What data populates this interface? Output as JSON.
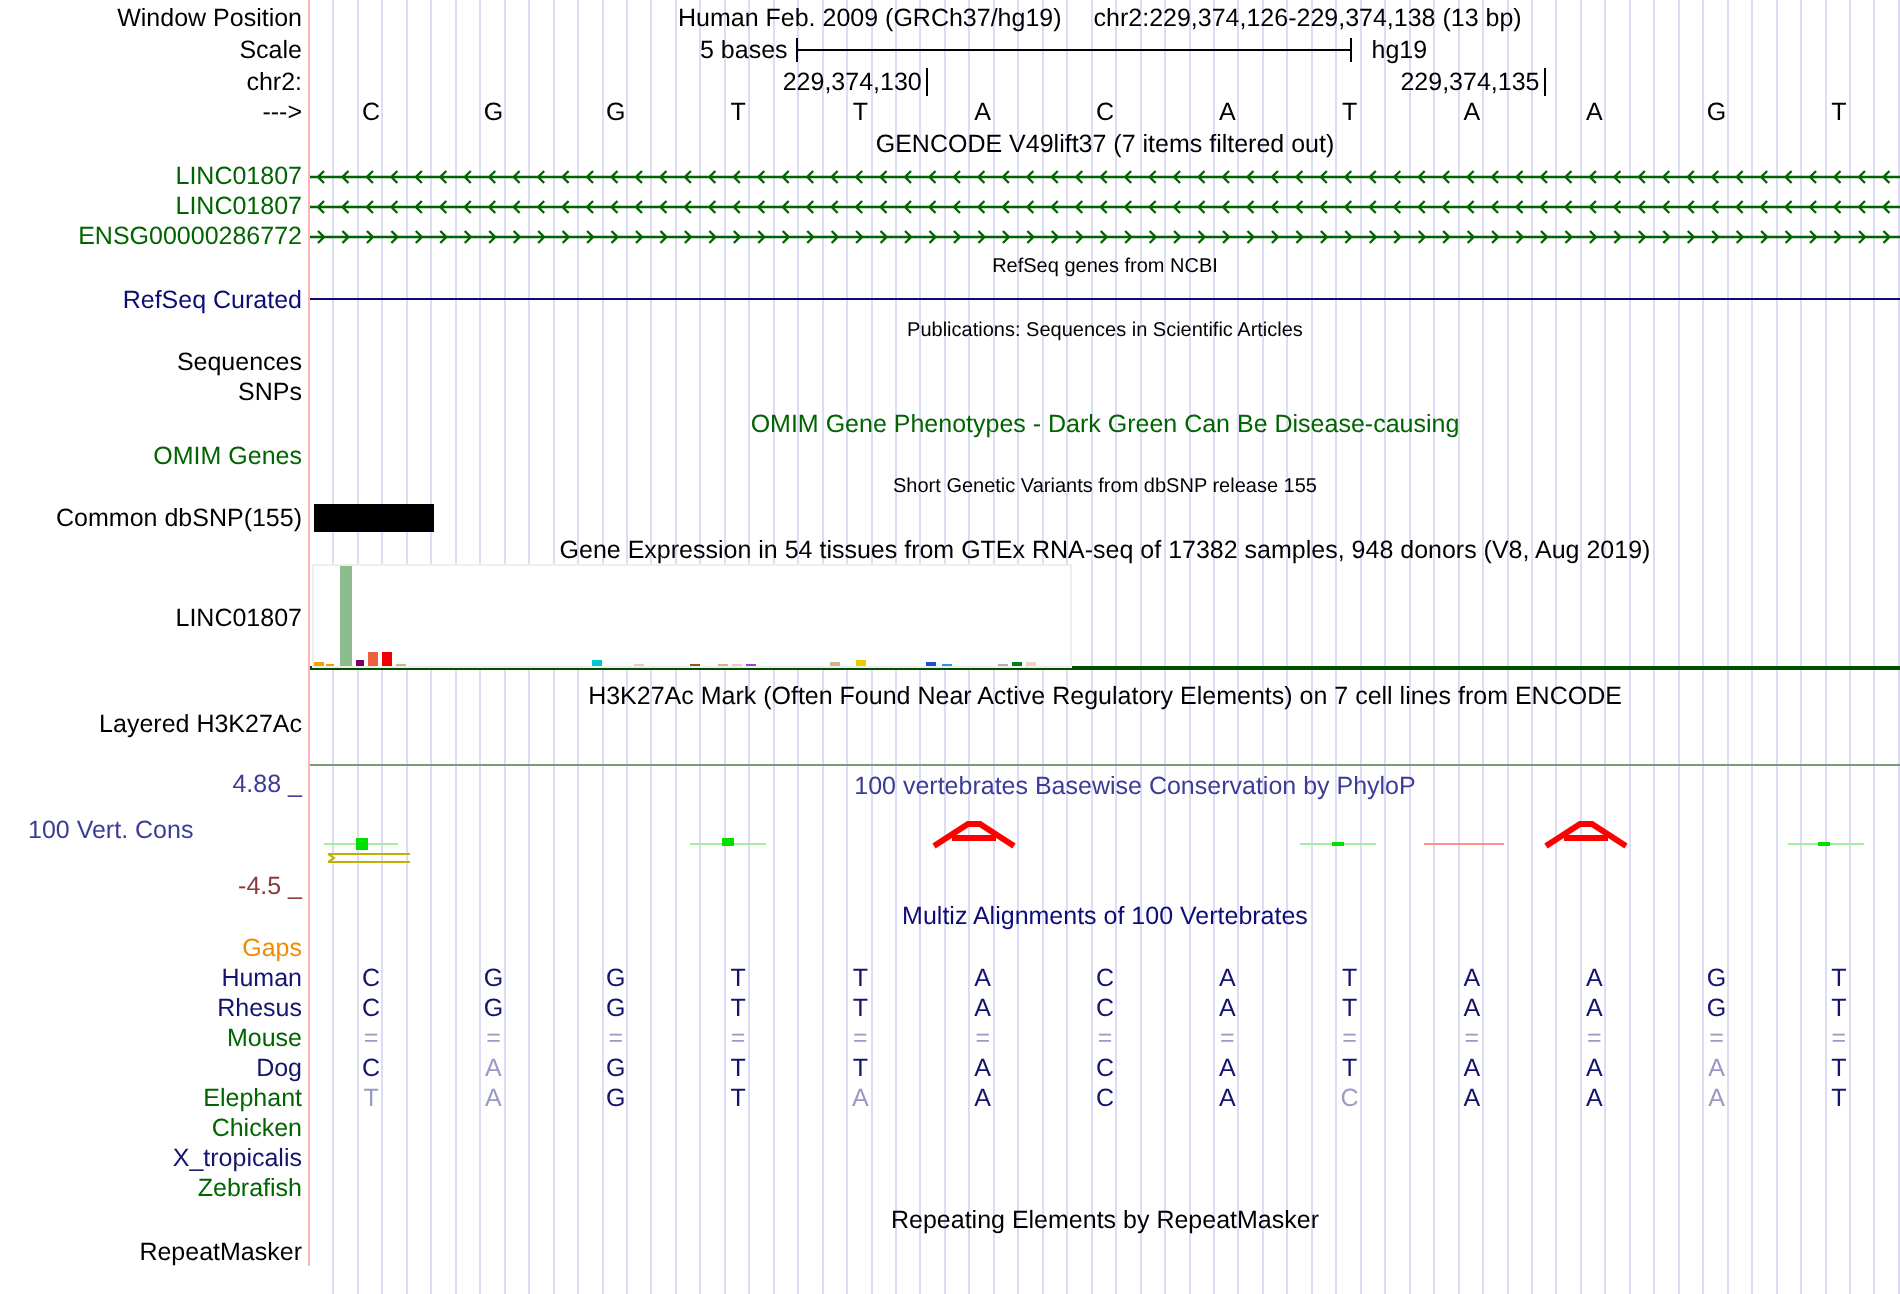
{
  "header": {
    "position_label": "Window Position",
    "assembly": "Human Feb. 2009 (GRCh37/hg19)",
    "position": "chr2:229,374,126-229,374,138 (13 bp)",
    "scale_label": "Scale",
    "scale_text": "5 bases",
    "scale_db": "hg19",
    "chrom_label": "chr2:",
    "strand_label": "--->",
    "bases": [
      {
        "base": "C"
      },
      {
        "base": "G"
      },
      {
        "base": "G"
      },
      {
        "base": "T"
      },
      {
        "base": "T",
        "tick": "229,374,130"
      },
      {
        "base": "A"
      },
      {
        "base": "C"
      },
      {
        "base": "A"
      },
      {
        "base": "T"
      },
      {
        "base": "A",
        "tick": "229,374,135"
      },
      {
        "base": "A"
      },
      {
        "base": "G"
      },
      {
        "base": "T"
      }
    ]
  },
  "tracks": [
    {
      "kind": "title",
      "text": "GENCODE V49lift37 (7 items filtered out)",
      "small": false
    },
    {
      "kind": "gene",
      "label": "LINC01807",
      "color": "#006400",
      "reverse": true
    },
    {
      "kind": "gene",
      "label": "LINC01807",
      "color": "#006400",
      "reverse": true
    },
    {
      "kind": "gene",
      "label": "ENSG00000286772",
      "color": "#006400",
      "reverse": false
    },
    {
      "kind": "title",
      "text": "RefSeq genes from NCBI",
      "small": true
    },
    {
      "kind": "line",
      "label": "RefSeq Curated",
      "color": "#0c0c78"
    },
    {
      "kind": "title",
      "text": "Publications: Sequences in Scientific Articles",
      "small": true
    },
    {
      "kind": "label",
      "label": "Sequences"
    },
    {
      "kind": "label",
      "label": "SNPs"
    },
    {
      "kind": "title",
      "text": "OMIM Gene Phenotypes - Dark Green Can Be Disease-causing",
      "small": false,
      "color": "#006400"
    },
    {
      "kind": "label",
      "label": "OMIM Genes",
      "color": "#006400"
    },
    {
      "kind": "title",
      "text": "Short Genetic Variants from dbSNP release 155",
      "small": true
    },
    {
      "kind": "snp",
      "label": "Common dbSNP(155)"
    },
    {
      "kind": "title",
      "text": "Gene Expression in 54 tissues from GTEx RNA-seq of 17382 samples, 948 donors (V8, Aug 2019)",
      "small": false
    },
    {
      "kind": "expression",
      "label": "LINC01807"
    },
    {
      "kind": "title",
      "text": "H3K27Ac Mark (Often Found Near Active Regulatory Elements) on 7 cell lines from ENCODE",
      "small": false,
      "tall": true
    },
    {
      "kind": "signal",
      "label": "Layered H3K27Ac"
    },
    {
      "kind": "conservation",
      "label": "100 Vert. Cons",
      "max_label": "4.88 _",
      "min_label": "-4.5 _",
      "title": "100 vertebrates Basewise Conservation by PhyloP"
    },
    {
      "kind": "title",
      "text": "Multiz Alignments of 100 Vertebrates",
      "small": false,
      "color": "#0c0c78"
    },
    {
      "kind": "label",
      "label": "Gaps",
      "color": "#f08c00"
    },
    {
      "kind": "alignment",
      "label": "Human",
      "color": "#14146e",
      "bases": [
        {
          "base": "C",
          "faded": false
        },
        {
          "base": "G",
          "faded": false
        },
        {
          "base": "G",
          "faded": false
        },
        {
          "base": "T",
          "faded": false
        },
        {
          "base": "T",
          "faded": false
        },
        {
          "base": "A",
          "faded": false
        },
        {
          "base": "C",
          "faded": false
        },
        {
          "base": "A",
          "faded": false
        },
        {
          "base": "T",
          "faded": false
        },
        {
          "base": "A",
          "faded": false
        },
        {
          "base": "A",
          "faded": false
        },
        {
          "base": "G",
          "faded": false
        },
        {
          "base": "T",
          "faded": false
        }
      ]
    },
    {
      "kind": "alignment",
      "label": "Rhesus",
      "color": "#14146e",
      "bases": [
        {
          "base": "C",
          "faded": false
        },
        {
          "base": "G",
          "faded": false
        },
        {
          "base": "G",
          "faded": false
        },
        {
          "base": "T",
          "faded": false
        },
        {
          "base": "T",
          "faded": false
        },
        {
          "base": "A",
          "faded": false
        },
        {
          "base": "C",
          "faded": false
        },
        {
          "base": "A",
          "faded": false
        },
        {
          "base": "T",
          "faded": false
        },
        {
          "base": "A",
          "faded": false
        },
        {
          "base": "A",
          "faded": false
        },
        {
          "base": "G",
          "faded": false
        },
        {
          "base": "T",
          "faded": false
        }
      ]
    },
    {
      "kind": "alignment",
      "label": "Mouse",
      "color": "#006400",
      "bases": [
        {
          "base": "=",
          "faded": true
        },
        {
          "base": "=",
          "faded": true
        },
        {
          "base": "=",
          "faded": true
        },
        {
          "base": "=",
          "faded": true
        },
        {
          "base": "=",
          "faded": true
        },
        {
          "base": "=",
          "faded": true
        },
        {
          "base": "=",
          "faded": true
        },
        {
          "base": "=",
          "faded": true
        },
        {
          "base": "=",
          "faded": true
        },
        {
          "base": "=",
          "faded": true
        },
        {
          "base": "=",
          "faded": true
        },
        {
          "base": "=",
          "faded": true
        },
        {
          "base": "=",
          "faded": true
        }
      ]
    },
    {
      "kind": "alignment",
      "label": "Dog",
      "color": "#14146e",
      "bases": [
        {
          "base": "C",
          "faded": false
        },
        {
          "base": "A",
          "faded": true
        },
        {
          "base": "G",
          "faded": false
        },
        {
          "base": "T",
          "faded": false
        },
        {
          "base": "T",
          "faded": false
        },
        {
          "base": "A",
          "faded": false
        },
        {
          "base": "C",
          "faded": false
        },
        {
          "base": "A",
          "faded": false
        },
        {
          "base": "T",
          "faded": false
        },
        {
          "base": "A",
          "faded": false
        },
        {
          "base": "A",
          "faded": false
        },
        {
          "base": "A",
          "faded": true
        },
        {
          "base": "T",
          "faded": false
        }
      ]
    },
    {
      "kind": "alignment",
      "label": "Elephant",
      "color": "#006400",
      "bases": [
        {
          "base": "T",
          "faded": true
        },
        {
          "base": "A",
          "faded": true
        },
        {
          "base": "G",
          "faded": false
        },
        {
          "base": "T",
          "faded": false
        },
        {
          "base": "A",
          "faded": true
        },
        {
          "base": "A",
          "faded": false
        },
        {
          "base": "C",
          "faded": false
        },
        {
          "base": "A",
          "faded": false
        },
        {
          "base": "C",
          "faded": true
        },
        {
          "base": "A",
          "faded": false
        },
        {
          "base": "A",
          "faded": false
        },
        {
          "base": "A",
          "faded": true
        },
        {
          "base": "T",
          "faded": false
        }
      ]
    },
    {
      "kind": "alignment",
      "label": "Chicken",
      "color": "#006400"
    },
    {
      "kind": "alignment",
      "label": "X_tropicalis",
      "color": "#14146e"
    },
    {
      "kind": "alignment",
      "label": "Zebrafish",
      "color": "#006400"
    },
    {
      "kind": "title",
      "text": "Repeating Elements by RepeatMasker",
      "small": false
    },
    {
      "kind": "label",
      "label": "RepeatMasker"
    }
  ]
}
